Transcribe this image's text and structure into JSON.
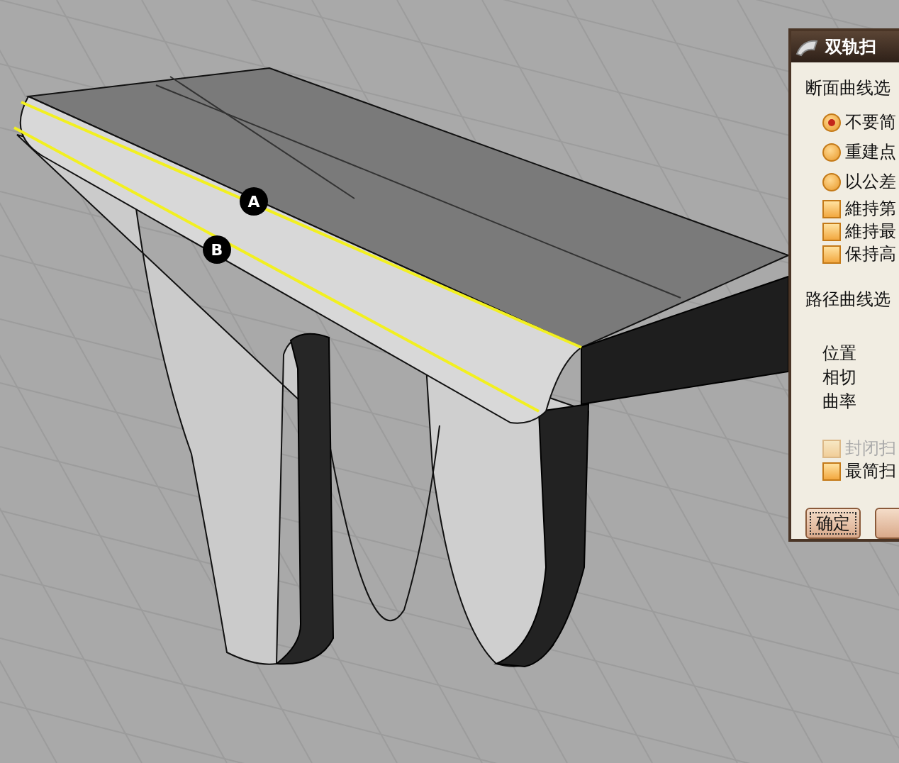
{
  "viewport": {
    "markers": [
      {
        "label": "A"
      },
      {
        "label": "B"
      }
    ]
  },
  "dialog": {
    "title": "双轨扫",
    "section_1": "断面曲线选",
    "radios": [
      {
        "label": "不要简",
        "selected": true
      },
      {
        "label": "重建点",
        "selected": false
      },
      {
        "label": "以公差",
        "selected": false
      }
    ],
    "checkboxes": [
      {
        "label": "維持第",
        "checked": false
      },
      {
        "label": "維持最",
        "checked": false
      },
      {
        "label": "保持高",
        "checked": false
      }
    ],
    "section_2": "路径曲线选",
    "path_options": [
      "位置",
      "相切",
      "曲率"
    ],
    "options": [
      {
        "label": "封闭扫",
        "checked": false,
        "disabled": true
      },
      {
        "label": "最简扫",
        "checked": false,
        "disabled": false
      }
    ],
    "buttons": [
      "确定"
    ]
  }
}
